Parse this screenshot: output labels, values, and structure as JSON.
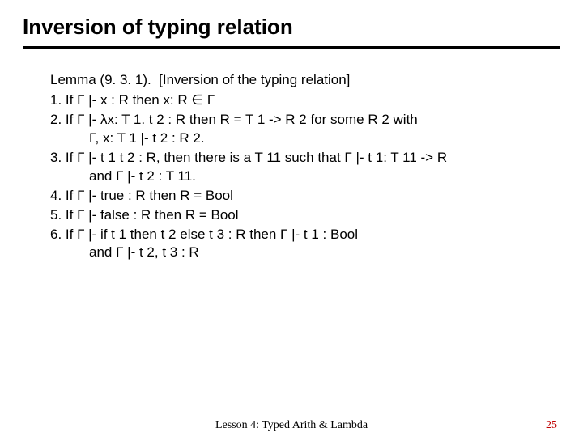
{
  "title": "Inversion of typing relation",
  "lemma": {
    "head": "Lemma (9. 3. 1).  [Inversion of the typing relation]",
    "items": [
      "1. If Γ |- x : R  then x: R  ∈ Γ",
      "2. If Γ |- λx: T 1. t 2 : R  then R = T 1 -> R 2 for some R 2 with",
      "3. If Γ |- t 1 t 2 : R,  then there is a T 11 such that Γ |- t 1: T 11 -> R",
      "4. If Γ |- true : R  then R = Bool",
      "5. If Γ |- false : R  then R = Bool",
      "6. If Γ |- if t 1 then t 2 else t 3 : R  then Γ |- t 1 : Bool"
    ],
    "cont2": "Γ, x: T 1 |- t 2 : R 2.",
    "cont3": "and Γ |- t 2 : T 11.",
    "cont6": "and Γ |- t 2, t 3 : R"
  },
  "footer": {
    "center": "Lesson 4: Typed Arith & Lambda",
    "page": "25"
  }
}
